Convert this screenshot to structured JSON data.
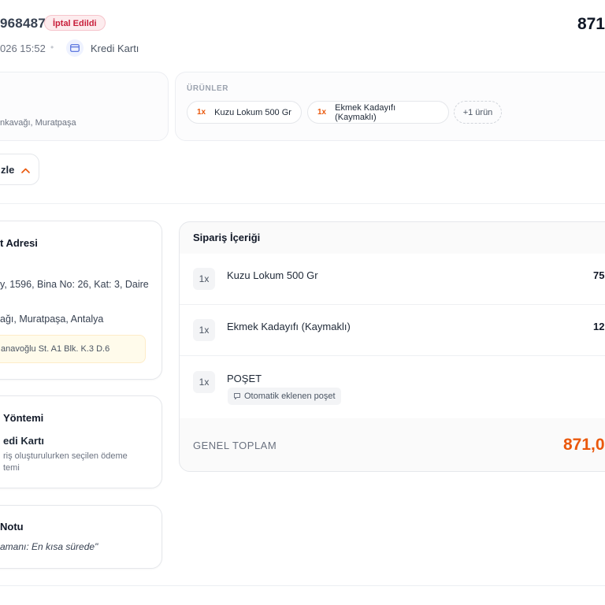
{
  "header": {
    "order_number": "968487",
    "status_badge": "İptal Edildi",
    "total_top": "871",
    "date_partial": "026 15:52",
    "payment_method": "Kredi Kartı"
  },
  "summary": {
    "address_partial": "nkavağı, Muratpaşa",
    "products_heading": "ÜRÜNLER",
    "product_chips": [
      {
        "qty": "1x",
        "name": "Kuzu Lokum 500 Gr"
      },
      {
        "qty": "1x",
        "name": "Ekmek Kadayıfı (Kaymaklı)"
      }
    ],
    "more_chip": "+1 ürün",
    "toggle_label": "zle"
  },
  "address_card": {
    "title": "t Adresi",
    "line1": "y, 1596, Bina No: 26, Kat: 3, Daire",
    "line2": "ağı, Muratpaşa, Antalya",
    "note": "anavoğlu St. A1 Blk. K.3 D.6"
  },
  "payment_card": {
    "title": "Yöntemi",
    "method": "edi Kartı",
    "desc_line1": "riş oluşturulurken seçilen ödeme",
    "desc_line2": "temi"
  },
  "note_card": {
    "title": "Notu",
    "text": "amanı: En kısa sürede\""
  },
  "order_items": {
    "title": "Sipariş İçeriği",
    "items": [
      {
        "qty": "1x",
        "name": "Kuzu Lokum 500 Gr",
        "price": "75"
      },
      {
        "qty": "1x",
        "name": "Ekmek Kadayıfı (Kaymaklı)",
        "price": "12"
      },
      {
        "qty": "1x",
        "name": "POŞET",
        "tag": "Otomatik eklenen poşet"
      }
    ],
    "grand_total_label": "GENEL TOPLAM",
    "grand_total_value": "871,0"
  },
  "colors": {
    "accent": "#ea580c",
    "cancel_badge": "#c81e3a",
    "note_background": "#fffbeb"
  }
}
